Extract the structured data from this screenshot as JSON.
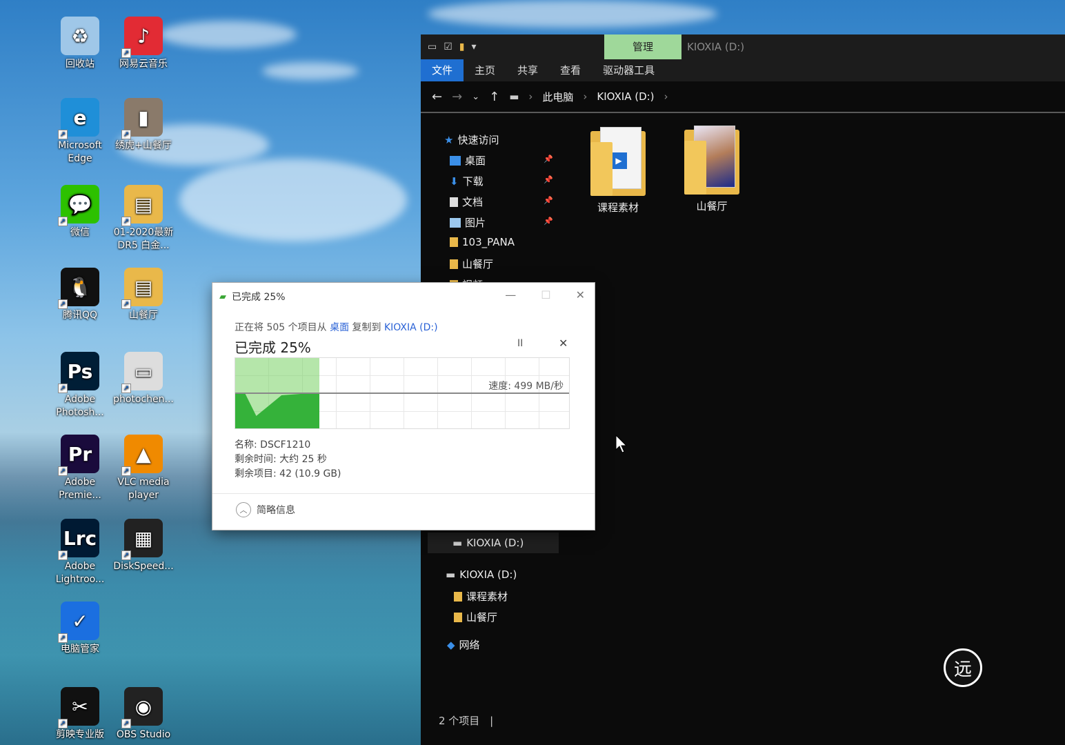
{
  "desktop": {
    "icons": [
      {
        "label": "回收站",
        "glyph": "♻",
        "color": "#9fc7e8",
        "icon": "recycle-bin-icon"
      },
      {
        "label": "网易云音乐",
        "glyph": "♪",
        "color": "#e22b34",
        "icon": "netease-music-icon"
      },
      {
        "label": "Microsoft Edge",
        "glyph": "e",
        "color": "#1f8fd8",
        "icon": "edge-icon"
      },
      {
        "label": "绣虎+山餐厅",
        "glyph": "▮",
        "color": "#8a7a6a",
        "icon": "image-file-icon"
      },
      {
        "label": "微信",
        "glyph": "💬",
        "color": "#2dc100",
        "icon": "wechat-icon"
      },
      {
        "label": "01-2020最新 DR5 白金...",
        "glyph": "▤",
        "color": "#e9b84a",
        "icon": "folder-icon"
      },
      {
        "label": "腾讯QQ",
        "glyph": "🐧",
        "color": "#111",
        "icon": "qq-icon"
      },
      {
        "label": "山餐厅",
        "glyph": "▤",
        "color": "#e9b84a",
        "icon": "folder-icon"
      },
      {
        "label": "Adobe Photosh...",
        "glyph": "Ps",
        "color": "#001e36",
        "icon": "photoshop-icon"
      },
      {
        "label": "photochen...",
        "glyph": "▭",
        "color": "#ddd",
        "icon": "image-file-icon"
      },
      {
        "label": "Adobe Premie...",
        "glyph": "Pr",
        "color": "#1a0b3c",
        "icon": "premiere-icon"
      },
      {
        "label": "VLC media player",
        "glyph": "▲",
        "color": "#f08a00",
        "icon": "vlc-icon"
      },
      {
        "label": "Adobe Lightroo...",
        "glyph": "Lrc",
        "color": "#001a33",
        "icon": "lightroom-icon"
      },
      {
        "label": "DiskSpeed...",
        "glyph": "▦",
        "color": "#222",
        "icon": "diskspeed-icon"
      },
      {
        "label": "电脑管家",
        "glyph": "✓",
        "color": "#1b6fe0",
        "icon": "pc-manager-icon"
      },
      {
        "label": "",
        "glyph": "",
        "color": "transparent",
        "icon": "empty"
      },
      {
        "label": "剪映专业版",
        "glyph": "✂",
        "color": "#111",
        "icon": "jianying-icon"
      },
      {
        "label": "OBS Studio",
        "glyph": "◉",
        "color": "#222",
        "icon": "obs-icon"
      }
    ]
  },
  "explorer": {
    "manage_tab": "管理",
    "title": "KIOXIA (D:)",
    "ribbon_tabs": [
      "文件",
      "主页",
      "共享",
      "查看",
      "驱动器工具"
    ],
    "breadcrumb": [
      "此电脑",
      "KIOXIA (D:)"
    ],
    "nav": {
      "quick_access": "快速访问",
      "desktop": "桌面",
      "downloads": "下载",
      "documents": "文档",
      "pictures": "图片",
      "pana": "103_PANA",
      "restaurant": "山餐厅",
      "videos_partial": "视频",
      "kioxia_1": "KIOXIA (D:)",
      "kioxia_2": "KIOXIA (D:)",
      "course": "课程素材",
      "restaurant_2": "山餐厅",
      "network": "网络"
    },
    "folders": [
      "课程素材",
      "山餐厅"
    ],
    "status": "2 个项目"
  },
  "dialog": {
    "title": "已完成 25%",
    "desc_prefix": "正在将 505 个项目从 ",
    "desc_source": "桌面",
    "desc_mid": " 复制到 ",
    "desc_dest": "KIOXIA (D:)",
    "percent_label": "已完成 25%",
    "progress_fraction": 0.25,
    "speed": "速度: 499 MB/秒",
    "name": "名称: DSCF1210",
    "time_left": "剩余时间: 大约 25 秒",
    "items_left": "剩余项目: 42 (10.9 GB)",
    "less_info": "简略信息",
    "pause_glyph": "II",
    "cancel_glyph": "✕",
    "min_glyph": "—",
    "max_glyph": "☐",
    "close_glyph": "✕"
  },
  "watermark": "远"
}
